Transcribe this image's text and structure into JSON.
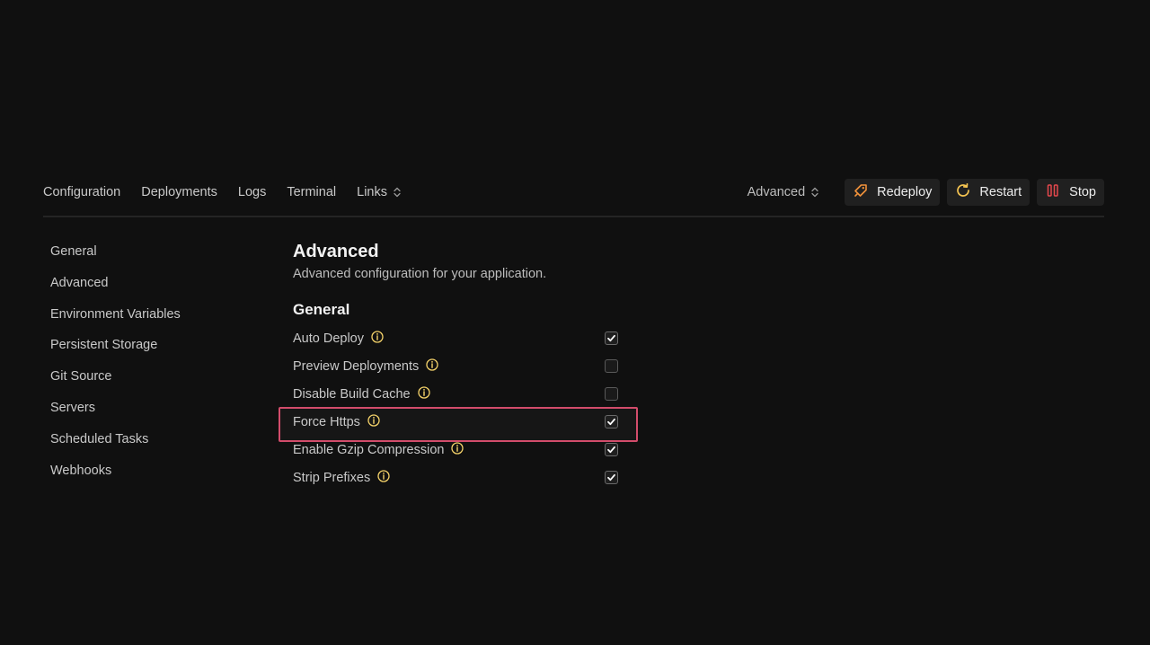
{
  "nav": {
    "tabs": [
      {
        "label": "Configuration"
      },
      {
        "label": "Deployments"
      },
      {
        "label": "Logs"
      },
      {
        "label": "Terminal"
      },
      {
        "label": "Links"
      }
    ]
  },
  "actions": {
    "select_value": "Advanced",
    "redeploy_label": "Redeploy",
    "restart_label": "Restart",
    "stop_label": "Stop",
    "colors": {
      "redeploy_icon": "#f0913a",
      "restart_icon": "#f5c451",
      "stop_icon": "#e5484d"
    }
  },
  "sidebar": {
    "items": [
      {
        "label": "General"
      },
      {
        "label": "Advanced"
      },
      {
        "label": "Environment Variables"
      },
      {
        "label": "Persistent Storage"
      },
      {
        "label": "Git Source"
      },
      {
        "label": "Servers"
      },
      {
        "label": "Scheduled Tasks"
      },
      {
        "label": "Webhooks"
      }
    ]
  },
  "main": {
    "title": "Advanced",
    "description": "Advanced configuration for your application.",
    "section_title": "General",
    "settings": [
      {
        "label": "Auto Deploy",
        "checked": true
      },
      {
        "label": "Preview Deployments",
        "checked": false
      },
      {
        "label": "Disable Build Cache",
        "checked": false
      },
      {
        "label": "Force Https",
        "checked": true,
        "highlighted": true
      },
      {
        "label": "Enable Gzip Compression",
        "checked": true
      },
      {
        "label": "Strip Prefixes",
        "checked": true
      }
    ],
    "info_icon_color": "#f5d36a",
    "highlight_color": "#d24c6b"
  }
}
